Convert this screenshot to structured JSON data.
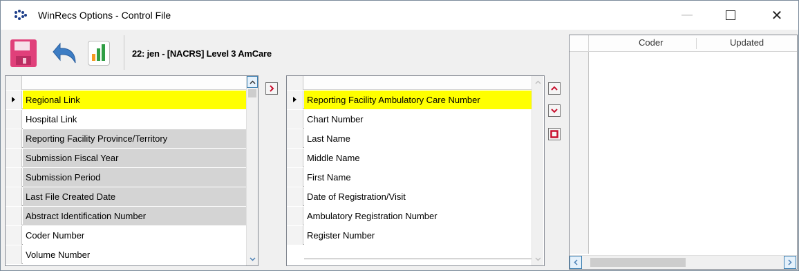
{
  "window": {
    "title": "WinRecs Options - Control File",
    "minimize_glyph": "—",
    "close_glyph": "✕"
  },
  "toolbar": {
    "record_label": "22: jen - [NACRS] Level 3 AmCare",
    "icons": [
      "save-icon",
      "undo-icon",
      "chart-icon"
    ]
  },
  "available_fields": [
    {
      "label": "Regional Link",
      "style": "selected"
    },
    {
      "label": "Hospital Link",
      "style": "normal"
    },
    {
      "label": "Reporting Facility Province/Territory",
      "style": "disabled"
    },
    {
      "label": "Submission Fiscal Year",
      "style": "disabled"
    },
    {
      "label": "Submission Period",
      "style": "disabled"
    },
    {
      "label": "Last File Created Date",
      "style": "disabled"
    },
    {
      "label": "Abstract Identification Number",
      "style": "disabled"
    },
    {
      "label": "Coder Number",
      "style": "normal"
    },
    {
      "label": "Volume Number",
      "style": "normal"
    }
  ],
  "selected_fields": [
    {
      "label": "Reporting Facility Ambulatory Care Number",
      "style": "selected"
    },
    {
      "label": "Chart Number",
      "style": "normal"
    },
    {
      "label": "Last Name",
      "style": "normal"
    },
    {
      "label": "Middle Name",
      "style": "normal"
    },
    {
      "label": "First Name",
      "style": "normal"
    },
    {
      "label": "Date of Registration/Visit",
      "style": "normal"
    },
    {
      "label": "Ambulatory Registration Number",
      "style": "normal"
    },
    {
      "label": "Register Number",
      "style": "normal"
    }
  ],
  "history_grid": {
    "columns": [
      "Coder",
      "Updated"
    ]
  },
  "colors": {
    "selected_row": "#ffff00",
    "disabled_row": "#d4d4d4",
    "accent_red": "#c8102e",
    "accent_blue": "#3d7dc4"
  }
}
